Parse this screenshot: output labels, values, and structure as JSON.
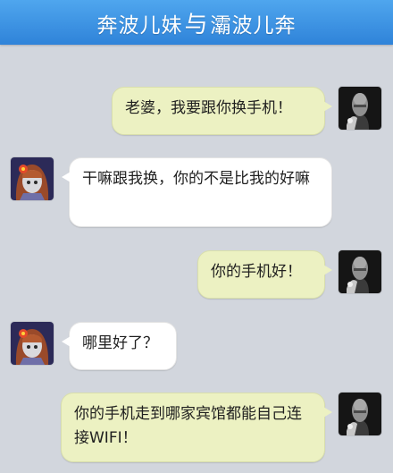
{
  "header": {
    "title_left": "奔波儿妹",
    "title_mid": "与",
    "title_right": "灞波儿奔"
  },
  "messages": [
    {
      "from": "me",
      "text": "老婆，我要跟你换手机！"
    },
    {
      "from": "them",
      "text": "干嘛跟我换，你的不是比我的好嘛"
    },
    {
      "from": "me",
      "text": "你的手机好！"
    },
    {
      "from": "them",
      "text": "哪里好了？"
    },
    {
      "from": "me",
      "text": "你的手机走到哪家宾馆都能自己连接WIFI！"
    }
  ],
  "colors": {
    "header_top": "#4fa6ee",
    "header_bottom": "#2f83d9",
    "chat_background": "#d2d6dd",
    "my_bubble": "#ecf1c2",
    "their_bubble": "#ffffff"
  },
  "avatars": {
    "me": "male-avatar-icon",
    "them": "female-avatar-icon"
  }
}
